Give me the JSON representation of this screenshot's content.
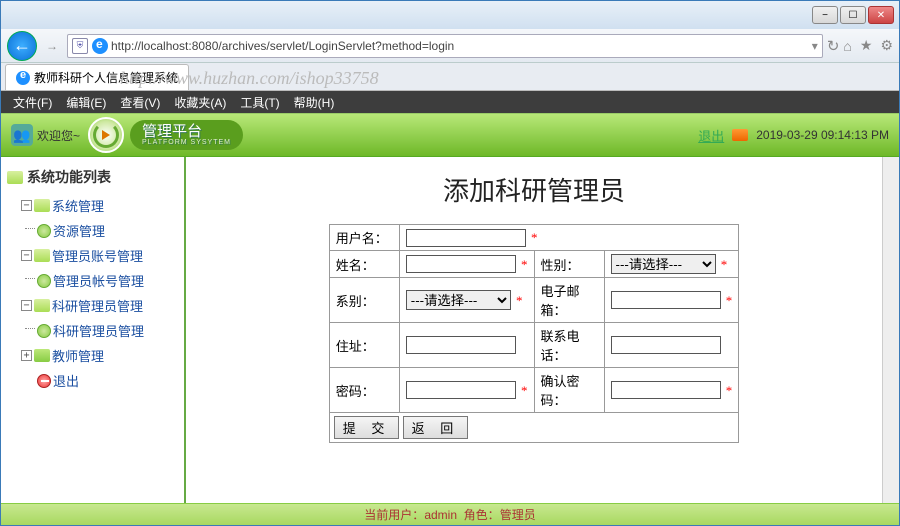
{
  "window": {
    "title_tab": "教师科研个人信息管理系统"
  },
  "browser": {
    "url": "http://localhost:8080/archives/servlet/LoginServlet?method=login",
    "menus": [
      "文件(F)",
      "编辑(E)",
      "查看(V)",
      "收藏夹(A)",
      "工具(T)",
      "帮助(H)"
    ]
  },
  "watermark": "http://www.huzhan.com/ishop33758",
  "header": {
    "welcome": "欢迎您~",
    "platform": "管理平台",
    "platform_sub": "PLATFORM SYSYTEM",
    "logout": "退出",
    "datetime": "2019-03-29 09:14:13 PM"
  },
  "sidebar": {
    "title": "系统功能列表",
    "items": [
      {
        "label": "系统管理",
        "type": "folder",
        "open": true,
        "level": 1,
        "children": [
          {
            "label": "资源管理",
            "type": "leaf",
            "level": 2
          }
        ]
      },
      {
        "label": "管理员账号管理",
        "type": "folder",
        "open": true,
        "level": 1,
        "children": [
          {
            "label": "管理员帐号管理",
            "type": "leaf",
            "level": 2
          }
        ]
      },
      {
        "label": "科研管理员管理",
        "type": "folder",
        "open": true,
        "level": 1,
        "children": [
          {
            "label": "科研管理员管理",
            "type": "leaf",
            "level": 2
          }
        ]
      },
      {
        "label": "教师管理",
        "type": "folder",
        "open": false,
        "level": 1,
        "children": []
      },
      {
        "label": "退出",
        "type": "stop",
        "level": 2
      }
    ]
  },
  "form": {
    "title": "添加科研管理员",
    "labels": {
      "username": "用户名：",
      "realname": "姓名：",
      "gender": "性别：",
      "dept": "系别：",
      "email": "电子邮箱：",
      "address": "住址：",
      "phone": "联系电话：",
      "password": "密码：",
      "confirm": "确认密码："
    },
    "placeholders": {
      "select": "---请选择---",
      "select2": "---请选择---"
    },
    "buttons": {
      "submit": "提 交",
      "back": "返 回"
    }
  },
  "status": {
    "current_user_label": "当前用户：",
    "current_user": "admin",
    "role_label": "角色：",
    "role": "管理员"
  }
}
